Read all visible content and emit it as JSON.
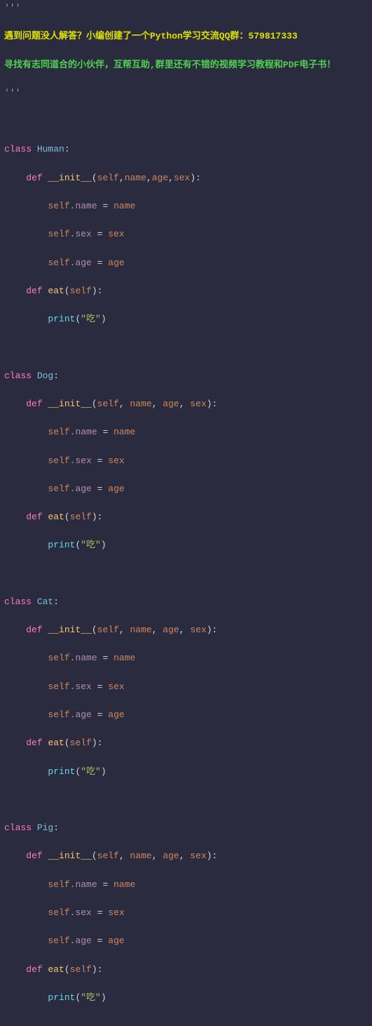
{
  "header": {
    "dots": "'''",
    "banner_line1_a": "遇到问题没人解答？小编创建了一个Python学习交流QQ群：",
    "banner_line1_b": "579817333",
    "banner_line2_a": "寻找有志同道合的小伙伴，互帮互助,群里还有不错的视频学习教程和PDF电子书！",
    "dots_close": "'''"
  },
  "code": {
    "kw_class": "class",
    "kw_def": "def",
    "init_name": "__init__",
    "eat_name": "eat",
    "self": "self",
    "p_name": "name",
    "p_age": "age",
    "p_sex": "sex",
    "attr_name": ".name",
    "attr_sex": ".sex",
    "attr_age": ".age",
    "assign_name": "name",
    "assign_sex": "sex",
    "assign_age": "age",
    "print": "print",
    "eat_str": "\"吃\"",
    "classes": {
      "c1": "Human",
      "c2": "Dog",
      "c3": "Cat",
      "c4": "Pig"
    },
    "sep_tight": ",",
    "sep_space": ", "
  }
}
